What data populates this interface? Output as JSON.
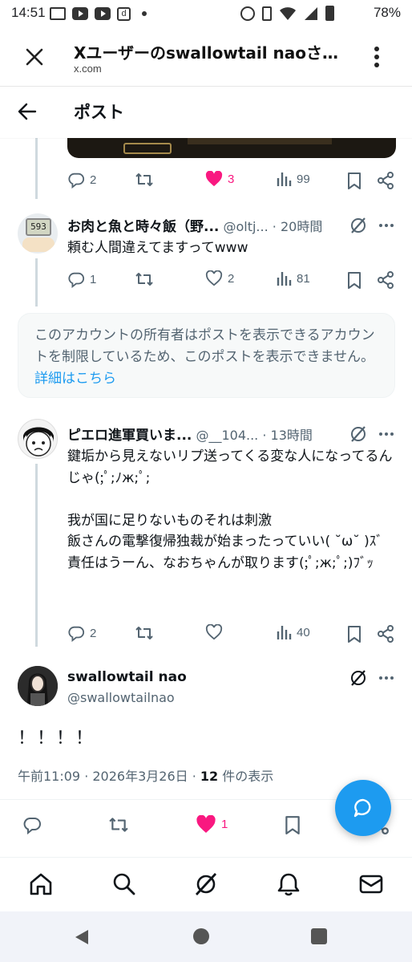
{
  "status_bar": {
    "time": "14:51",
    "battery": "78%",
    "icons": [
      "notification-icon",
      "youtube-icon",
      "youtube-icon",
      "d-app-icon",
      "dot-icon",
      "alarm-icon",
      "vibrate-icon",
      "wifi-icon",
      "signal-icon",
      "battery-icon"
    ]
  },
  "browser": {
    "title": "Xユーザーのswallowtail naoさん…",
    "url": "x.com"
  },
  "header": {
    "title": "ポスト"
  },
  "first_post_actions": {
    "replies": "2",
    "reposts": "",
    "likes": "3",
    "views": "99"
  },
  "replies": [
    {
      "display_name": "お肉と魚と時々飯（野...",
      "handle": "@oltj...",
      "time": "· 20時間",
      "text": "頼む人間違えてますってwww",
      "replies": "1",
      "likes": "2",
      "views": "81"
    },
    {
      "display_name": "ピエロ進軍買いま...",
      "handle": "@__104...",
      "time": "· 13時間",
      "text": "鍵垢から見えないリプ送ってくる変な人になってるんじゃ(;ﾟ;ﾉж;ﾟ;\n\n我が国に足りないものそれは刺激\n飯さんの電撃復帰独裁が始まったっていい( ˘ω˘ )ｽﾞ\n責任はうーん、なおちゃんが取ります(;ﾟ;ж;ﾟ;)ﾌﾞｯ",
      "replies": "2",
      "likes": "",
      "views": "40"
    }
  ],
  "notice": {
    "text": "このアカウントの所有者はポストを表示できるアカウントを制限しているため、このポストを表示できません。",
    "link": "詳細はこちら"
  },
  "main_post": {
    "display_name": "swallowtail nao",
    "handle": "@swallowtailnao",
    "text": "！！！！",
    "timestamp": "午前11:09 · 2026年3月26日 · ",
    "view_count": "12",
    "view_label": " 件の表示",
    "likes": "1"
  },
  "colors": {
    "like_pink": "#f91880",
    "accent_blue": "#1d9bf0",
    "muted": "#536471"
  }
}
